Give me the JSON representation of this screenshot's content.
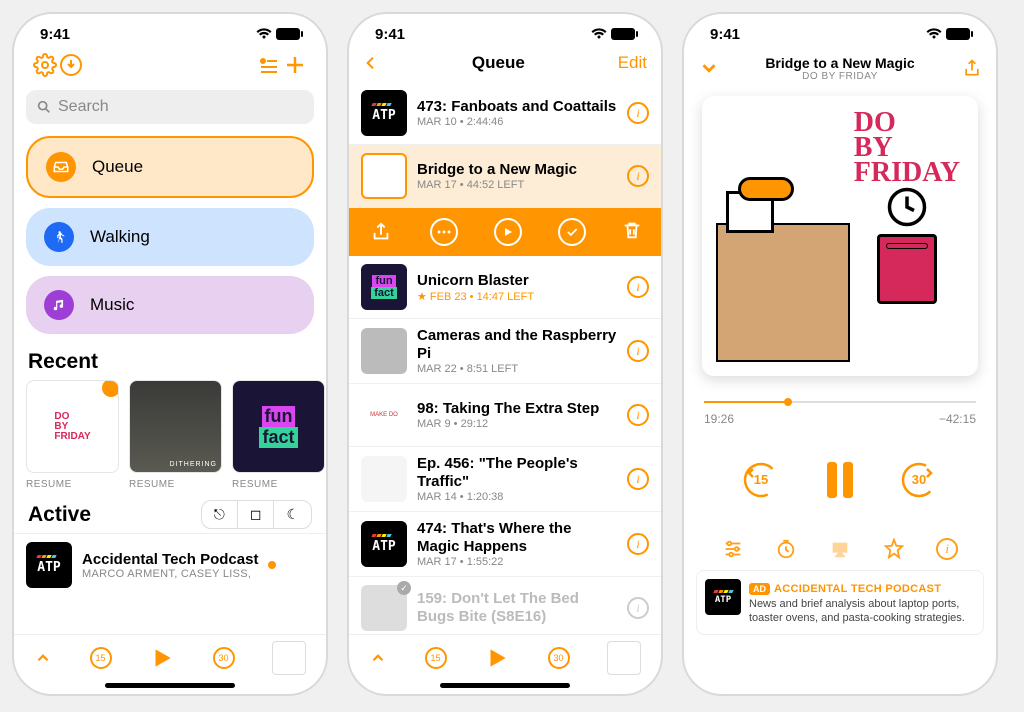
{
  "status": {
    "time": "9:41"
  },
  "screen1": {
    "search": {
      "placeholder": "Search"
    },
    "playlists": [
      {
        "label": "Queue"
      },
      {
        "label": "Walking"
      },
      {
        "label": "Music"
      }
    ],
    "recent_heading": "Recent",
    "recent": [
      {
        "resume": "RESUME"
      },
      {
        "resume": "RESUME"
      },
      {
        "resume": "RESUME"
      }
    ],
    "active_heading": "Active",
    "podcast": {
      "title": "Accidental Tech Podcast",
      "authors": "MARCO ARMENT, CASEY LISS,"
    },
    "skip_back": "15",
    "skip_fwd": "30"
  },
  "screen2": {
    "title": "Queue",
    "edit": "Edit",
    "episodes": [
      {
        "title": "473: Fanboats and Coattails",
        "meta": "MAR 10 • 2:44:46",
        "thumb": "atp"
      },
      {
        "title": "Bridge to a New Magic",
        "meta": "MAR 17 • 44:52 LEFT",
        "thumb": "dbf",
        "selected": true
      },
      {
        "title": "Unicorn Blaster",
        "meta": "★ FEB 23 • 14:47 LEFT",
        "thumb": "funfact"
      },
      {
        "title": "Cameras and the Raspberry Pi",
        "meta": "MAR 22 • 8:51 LEFT",
        "thumb": "gray"
      },
      {
        "title": "98: Taking The Extra Step",
        "meta": "MAR 9 • 29:12",
        "thumb": "makedo"
      },
      {
        "title": "Ep. 456: \"The People's Traffic\"",
        "meta": "MAR 14 • 1:20:38",
        "thumb": "white"
      },
      {
        "title": "474: That's Where the Magic Happens",
        "meta": "MAR 17 • 1:55:22",
        "thumb": "atp"
      },
      {
        "title": "159: Don't Let The Bed Bugs Bite (S8E16)",
        "meta": "",
        "thumb": "gray",
        "dim": true
      }
    ],
    "skip_back": "15",
    "skip_fwd": "30"
  },
  "screen3": {
    "title": "Bridge to a New Magic",
    "subtitle": "DO BY FRIDAY",
    "art_text": "DO BY FRIDAY",
    "elapsed": "19:26",
    "remaining": "−42:15",
    "skip_back": "15",
    "skip_fwd": "30",
    "ad": {
      "badge": "AD",
      "name": "ACCIDENTAL TECH PODCAST",
      "text": "News and brief analysis about laptop ports, toaster ovens, and pasta-cooking strategies."
    }
  }
}
